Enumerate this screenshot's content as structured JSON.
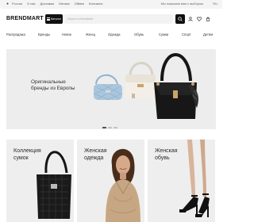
{
  "topbar": {
    "location": "Россия",
    "links": [
      "О нас",
      "Доставка",
      "Оплата",
      "Обмен",
      "Контакты"
    ],
    "hint": "Мы поможем вам с выбором",
    "lang": "RU"
  },
  "header": {
    "logo": "BRENDMART",
    "catalog_label": "Каталог",
    "search_placeholder": "Искать в BrendMart"
  },
  "catnav": {
    "items": [
      "Распродажа",
      "Бренды",
      "Новое",
      "Женщ",
      "Одежда",
      "Обувь",
      "Сумки",
      "Спорт",
      "Детям"
    ]
  },
  "hero": {
    "line1": "Оригинальные",
    "line2": "бренды из Европы",
    "slides_total": 3,
    "active_slide": 1
  },
  "cards": [
    {
      "line1": "Коллекция",
      "line2": "сумок"
    },
    {
      "line1": "Женская",
      "line2": "одежда"
    },
    {
      "line1": "Женская",
      "line2": "обувь"
    }
  ],
  "colors": {
    "accent": "#111111",
    "banner_bg": "#ededed",
    "card_bg": "#eeeeee"
  }
}
